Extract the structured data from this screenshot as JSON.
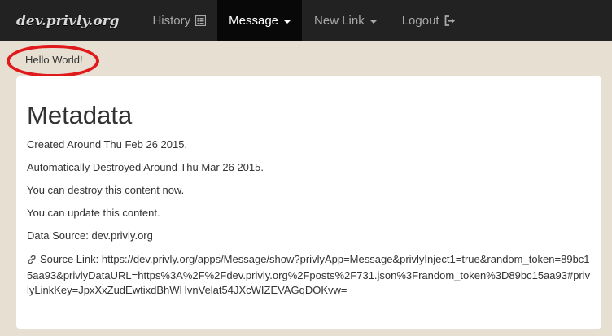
{
  "nav": {
    "brand": "dev.privly.org",
    "history": "History",
    "message": "Message",
    "new_link": "New Link",
    "logout": "Logout"
  },
  "message_text": "Hello World!",
  "metadata": {
    "title": "Metadata",
    "created": "Created Around Thu Feb 26 2015.",
    "destroyed": "Automatically Destroyed Around Thu Mar 26 2015.",
    "can_destroy": "You can destroy this content now.",
    "can_update": "You can update this content.",
    "data_source": "Data Source: dev.privly.org",
    "source_link": "Source Link: https://dev.privly.org/apps/Message/show?privlyApp=Message&privlyInject1=true&random_token=89bc15aa93&privlyDataURL=https%3A%2F%2Fdev.privly.org%2Fposts%2F731.json%3Frandom_token%3D89bc15aa93#privlyLinkKey=JpxXxZudEwtixdBhWHvnVelat54JXcWIZEVAGqDOKvw="
  },
  "colors": {
    "navbar": "#222222",
    "active_tab": "#080808",
    "background": "#e6dfd2",
    "highlight": "#e0191a"
  },
  "icons": [
    "list-icon",
    "caret-down-icon",
    "logout-icon",
    "link-icon"
  ]
}
